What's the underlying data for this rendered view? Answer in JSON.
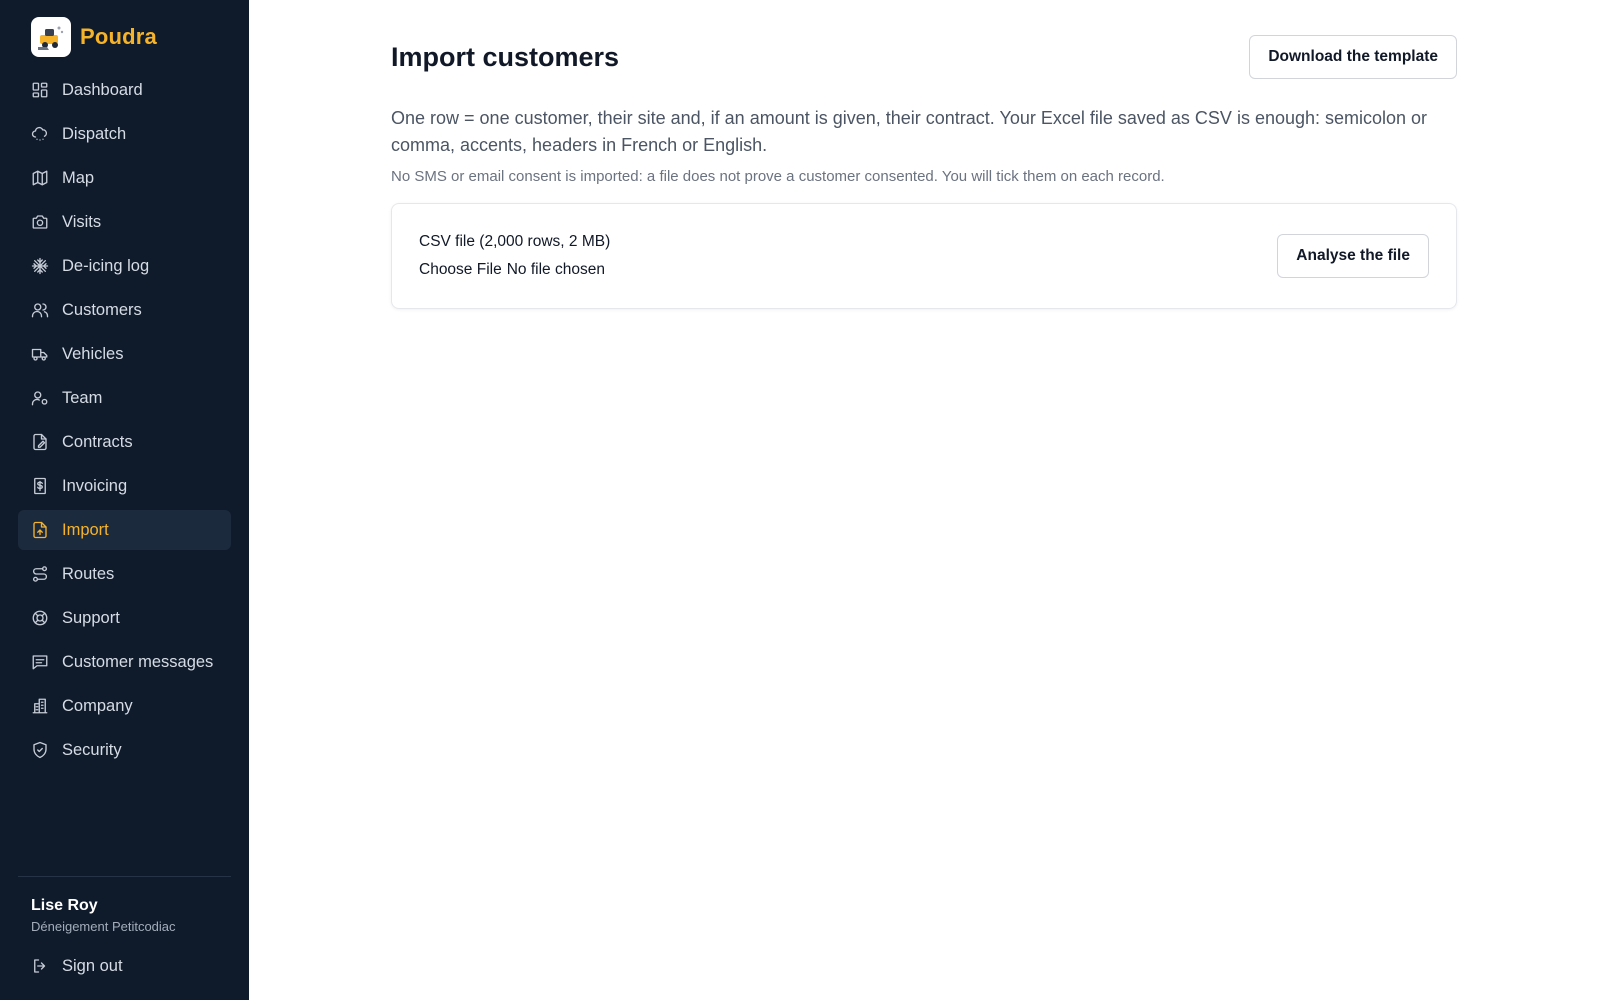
{
  "brand": {
    "name": "Poudra",
    "accent": "#f5b32b"
  },
  "sidebar": {
    "items": [
      {
        "label": "Dashboard",
        "icon": "dashboard-icon"
      },
      {
        "label": "Dispatch",
        "icon": "cloud-snow-icon"
      },
      {
        "label": "Map",
        "icon": "map-icon"
      },
      {
        "label": "Visits",
        "icon": "camera-icon"
      },
      {
        "label": "De-icing log",
        "icon": "snowflake-icon"
      },
      {
        "label": "Customers",
        "icon": "users-icon"
      },
      {
        "label": "Vehicles",
        "icon": "truck-icon"
      },
      {
        "label": "Team",
        "icon": "user-gear-icon"
      },
      {
        "label": "Contracts",
        "icon": "file-edit-icon"
      },
      {
        "label": "Invoicing",
        "icon": "receipt-icon"
      },
      {
        "label": "Import",
        "icon": "file-upload-icon",
        "active": true
      },
      {
        "label": "Routes",
        "icon": "route-icon"
      },
      {
        "label": "Support",
        "icon": "lifebuoy-icon"
      },
      {
        "label": "Customer messages",
        "icon": "message-icon"
      },
      {
        "label": "Company",
        "icon": "building-icon"
      },
      {
        "label": "Security",
        "icon": "shield-icon"
      }
    ],
    "user": {
      "name": "Lise Roy",
      "company": "Déneigement Petitcodiac"
    },
    "signout_label": "Sign out"
  },
  "main": {
    "title": "Import customers",
    "download_label": "Download the template",
    "lead": "One row = one customer, their site and, if an amount is given, their contract. Your Excel file saved as CSV is enough: semicolon or comma, accents, headers in French or English.",
    "note": "No SMS or email consent is imported: a file does not prove a customer consented. You will tick them on each record.",
    "upload": {
      "label": "CSV file (2,000 rows, 2 MB)",
      "choose_label": "Choose File",
      "status": "No file chosen",
      "analyse_label": "Analyse the file"
    }
  }
}
